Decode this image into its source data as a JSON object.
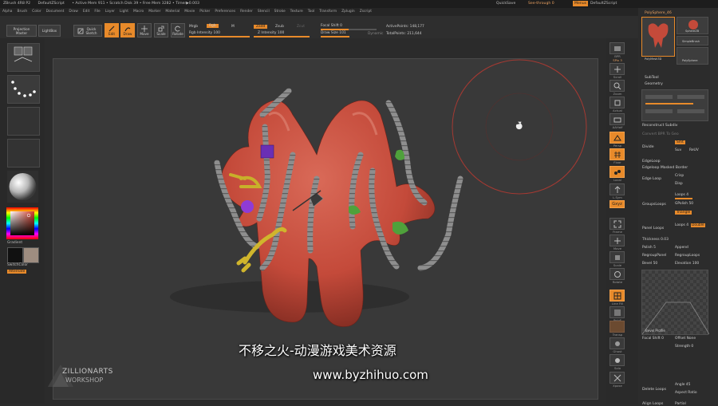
{
  "title_bar": {
    "app": "ZBrush 4R8 P2",
    "document": "DefaultZScript",
    "active_mem": "• Active Mem 911 • Scratch Disk 39 • Free Mem 3282 • Timer▶0.003",
    "quicksave": "QuickSave",
    "see_through": "See-through 0",
    "menus_toggle": "Menus",
    "default_script": "DefaultZScript"
  },
  "menus": [
    "Alpha",
    "Brush",
    "Color",
    "Document",
    "Draw",
    "Edit",
    "File",
    "Layer",
    "Light",
    "Macro",
    "Marker",
    "Material",
    "Movie",
    "Picker",
    "Preferences",
    "Render",
    "Stencil",
    "Stroke",
    "Texture",
    "Tool",
    "Transform",
    "Zplugin",
    "Zscript"
  ],
  "toolbar": {
    "projection_master": "Projection Master",
    "lightbox": "LightBox",
    "quick_sketch": "Quick Sketch",
    "edit": "Edit",
    "draw": "Draw",
    "move": "Move",
    "scale": "Scale",
    "rotate": "Rotate",
    "mrgb": "Mrgb",
    "rgb": "Rgb",
    "m": "M",
    "rgb_intensity": "Rgb Intensity 100",
    "zadd": "Zadd",
    "zsub": "Zsub",
    "zcut": "Zcut",
    "z_intensity": "Z Intensity 100",
    "focal_shift": "Focal Shift 0",
    "draw_size": "Draw Size 101",
    "dynamic": "Dynamic",
    "active_points": "ActivePoints: 148,177",
    "total_points": "TotalPoints: 211,644"
  },
  "left_shelf": {
    "gradient": "Gradient",
    "switch_color": "SwitchColor",
    "alternate": "Alternate"
  },
  "right_shelf": {
    "labels": [
      "BPR",
      "SPix 3",
      "Scroll",
      "Zoom",
      "Actual",
      "AAHalf",
      "Persp",
      "Floor",
      "Local",
      "L.Sym",
      "Gxyz",
      "Frame",
      "Move",
      "Scale",
      "Rotate",
      "Line Fill",
      "PolyF",
      "Transp",
      "Ghost",
      "Solo",
      "Xpose"
    ],
    "spix_value": "3"
  },
  "tray": {
    "tool_name": "PolySphere_46",
    "tool_thumbs": [
      "PolySphere_46",
      "SphereZB",
      "SimpleBrush",
      "PolyMesh3D",
      "PolySphere"
    ],
    "sections": {
      "subtool": "SubTool",
      "geometry": "Geometry",
      "reconstruct_subdiv": "Reconstruct Subdiv",
      "convert_bpr": "Convert BPR To Geo",
      "divide": "Divide",
      "smt": "Smt",
      "suv": "Suv",
      "reuv": "ReUV",
      "edgeloop": "EdgeLoop",
      "edgeloop_masked_border": "Edgeloop Masked Border",
      "edge_loop": "Edge Loop",
      "crisp": "Crisp",
      "disp": "Disp",
      "group_loops": "GroupsLoops",
      "loops": "Loops 4",
      "gpolish": "GPolish 50",
      "triangle": "Triangle",
      "panel_loops": "Panel Loops",
      "double": "Double",
      "thickness": "Thickness 0.03",
      "polish": "Polish 5",
      "append": "Append",
      "regroup_panel": "RegroupPanel",
      "regroup_loops": "RegroupLoops",
      "bevel": "Bevel 50",
      "elevation": "Elevation 100",
      "bevel_profile": "Bevel Profile",
      "focal_shift": "Focal Shift 0",
      "offset": "Offset None",
      "strength": "Strength 0",
      "delete_loops": "Delete Loops",
      "angle": "Angle 45",
      "aspect_ratio": "Aspect Ratio",
      "align_loops": "Align Loops",
      "partial": "Partial"
    }
  },
  "watermark": {
    "logo": "ZILLIONARTS",
    "logo_sub": "WORKSHOP",
    "caption_line1": "不移之火-动漫游戏美术资源",
    "caption_line2": "www.byzhihuo.com"
  },
  "colors": {
    "accent": "#e88a2a",
    "model": "#c44a3a",
    "canvas": "#393939"
  }
}
